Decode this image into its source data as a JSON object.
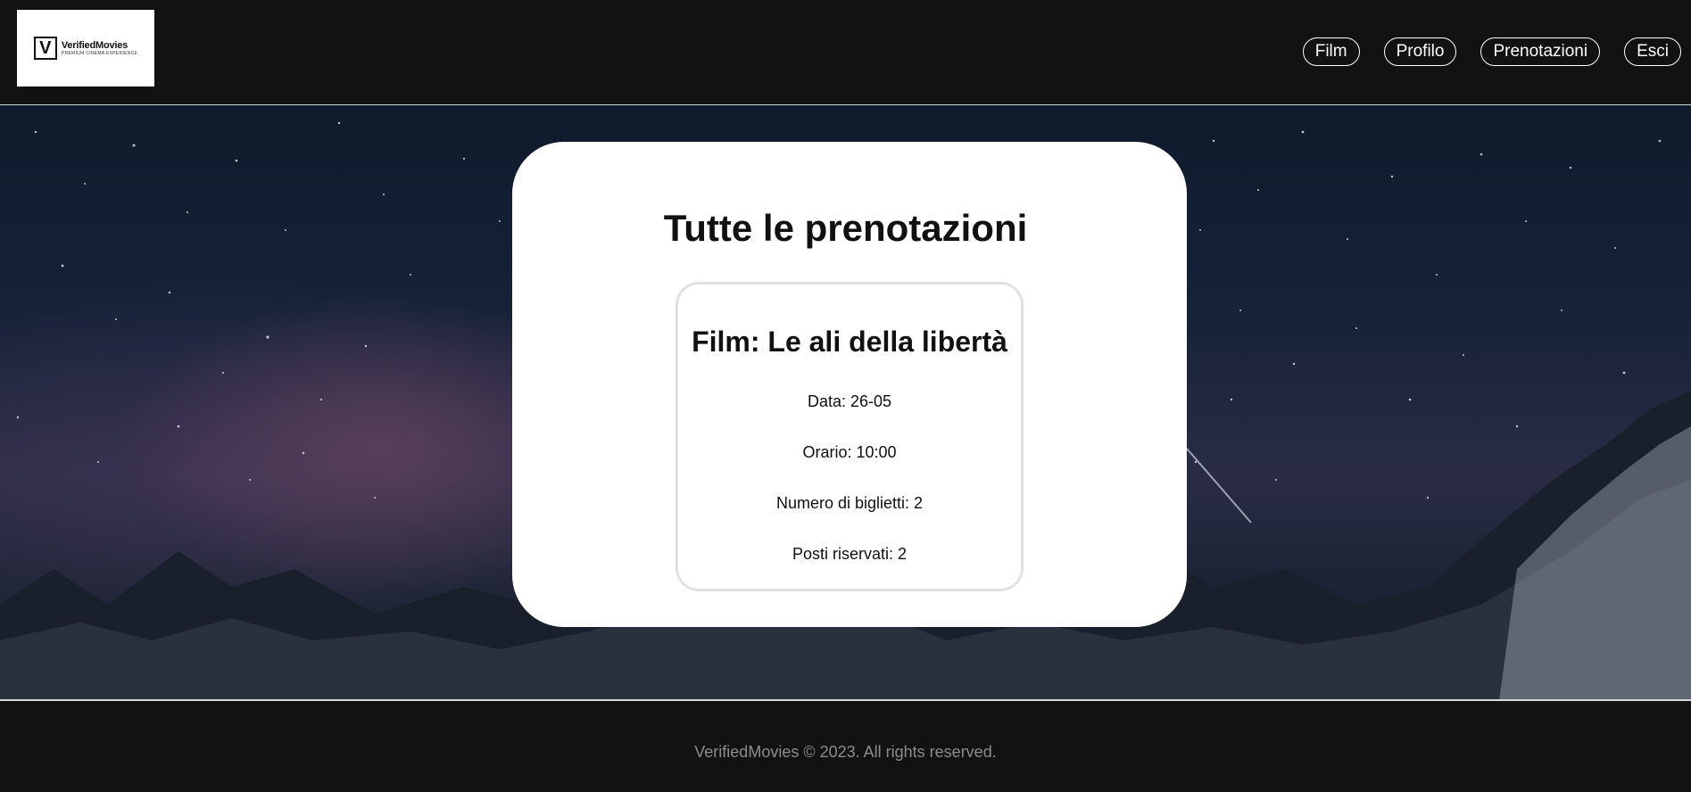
{
  "brand": {
    "name": "VerifiedMovies",
    "mark": "V",
    "tagline": "PREMIUM CINEMA EXPERIENCE"
  },
  "nav": {
    "items": [
      {
        "label": "Film"
      },
      {
        "label": "Profilo"
      },
      {
        "label": "Prenotazioni"
      },
      {
        "label": "Esci"
      }
    ]
  },
  "page": {
    "title": "Tutte le prenotazioni"
  },
  "bookings": [
    {
      "film": "Film: Le ali della libertà",
      "date": "Data: 26-05",
      "time": "Orario: 10:00",
      "tickets": "Numero di biglietti: 2",
      "seats": "Posti riservati: 2"
    }
  ],
  "footer": {
    "copyright": "VerifiedMovies © 2023. All rights reserved."
  },
  "colors": {
    "header_bg": "#121212",
    "card_bg": "#ffffff",
    "nav_border": "#ffffff",
    "footer_text": "#8c8c8c"
  }
}
